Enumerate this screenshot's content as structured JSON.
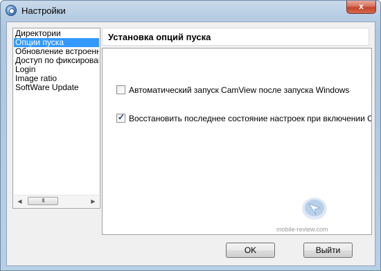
{
  "window": {
    "title": "Настройки",
    "close_symbol": "x"
  },
  "sidebar": {
    "items": [
      {
        "label": "Директории",
        "selected": false
      },
      {
        "label": "Опции пуска",
        "selected": true
      },
      {
        "label": "Обновление встроенного",
        "selected": false
      },
      {
        "label": "Доступ по фиксированному",
        "selected": false
      },
      {
        "label": "Login",
        "selected": false
      },
      {
        "label": "Image ratio",
        "selected": false
      },
      {
        "label": "SoftWare Update",
        "selected": false
      }
    ],
    "scrollbar": {
      "left_arrow": "◀",
      "right_arrow": "▶",
      "thumb_grip": "III"
    }
  },
  "panel": {
    "title": "Установка опций пуска",
    "options": [
      {
        "label": "Автоматический запуск CamView после запуска Windows",
        "checked": false
      },
      {
        "label": "Восстановить последнее состояние настроек при включении CamView",
        "checked": true
      }
    ],
    "check_mark": "✓"
  },
  "watermark": {
    "text": "mobile-review.com"
  },
  "buttons": {
    "ok": "OK",
    "exit": "Выйти"
  },
  "colors": {
    "selection": "#3399ff",
    "close_button": "#c4432c",
    "check_mark": "#1c3f7a"
  }
}
